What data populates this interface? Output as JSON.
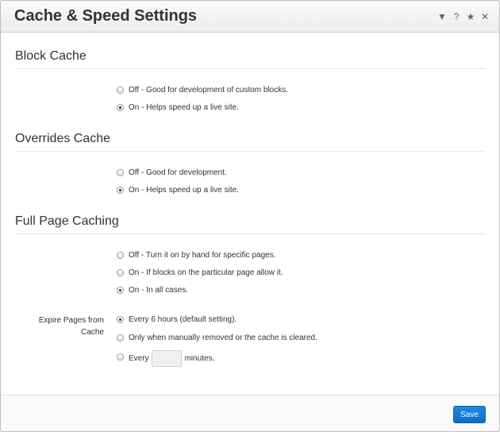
{
  "dialog": {
    "title": "Cache & Speed Settings",
    "icons": [
      "dropdown-triangle-icon",
      "help-icon",
      "star-icon",
      "close-icon"
    ]
  },
  "sections": [
    {
      "heading": "Block Cache",
      "options": [
        {
          "label": "Off - Good for development of custom blocks.",
          "selected": false
        },
        {
          "label": "On - Helps speed up a live site.",
          "selected": true
        }
      ]
    },
    {
      "heading": "Overrides Cache",
      "options": [
        {
          "label": "Off - Good for development.",
          "selected": false
        },
        {
          "label": "On - Helps speed up a live site.",
          "selected": true
        }
      ]
    },
    {
      "heading": "Full Page Caching",
      "options": [
        {
          "label": "Off - Turn it on by hand for specific pages.",
          "selected": false
        },
        {
          "label": "On - If blocks on the particular page allow it.",
          "selected": false
        },
        {
          "label": "On - In all cases.",
          "selected": true
        }
      ]
    }
  ],
  "expire": {
    "label": "Expire Pages from Cache",
    "options": [
      {
        "label": "Every 6 hours (default setting).",
        "selected": true
      },
      {
        "label": "Only when manually removed or the cache is cleared.",
        "selected": false
      }
    ],
    "custom": {
      "prefix": "Every",
      "suffix": "minutes.",
      "value": "",
      "selected": false
    }
  },
  "footer": {
    "save_label": "Save"
  }
}
